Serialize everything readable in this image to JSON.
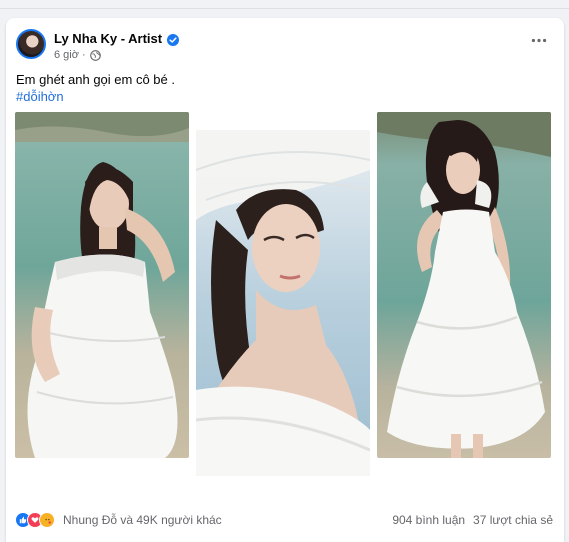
{
  "post": {
    "author": "Ly Nha Ky - Artist",
    "time": "6 giờ ·",
    "caption": "Em ghét anh gọi em cô bé .",
    "hashtag": "#dỗihờn"
  },
  "footer": {
    "reactors": "Nhung Đỗ và 49K người khác",
    "comments": "904 bình luận",
    "shares": "37 lượt chia sẻ"
  },
  "icons": {
    "verified": "verified-badge-icon",
    "audience": "globe-icon",
    "more": "more-horizontal-icon",
    "reactions": [
      "like-icon",
      "love-icon",
      "care-icon"
    ]
  },
  "colors": {
    "brand_blue": "#1877f2",
    "hashtag": "#216fdb",
    "secondary_text": "#65676b",
    "love": "#f33e58",
    "care": "#f7b125"
  }
}
